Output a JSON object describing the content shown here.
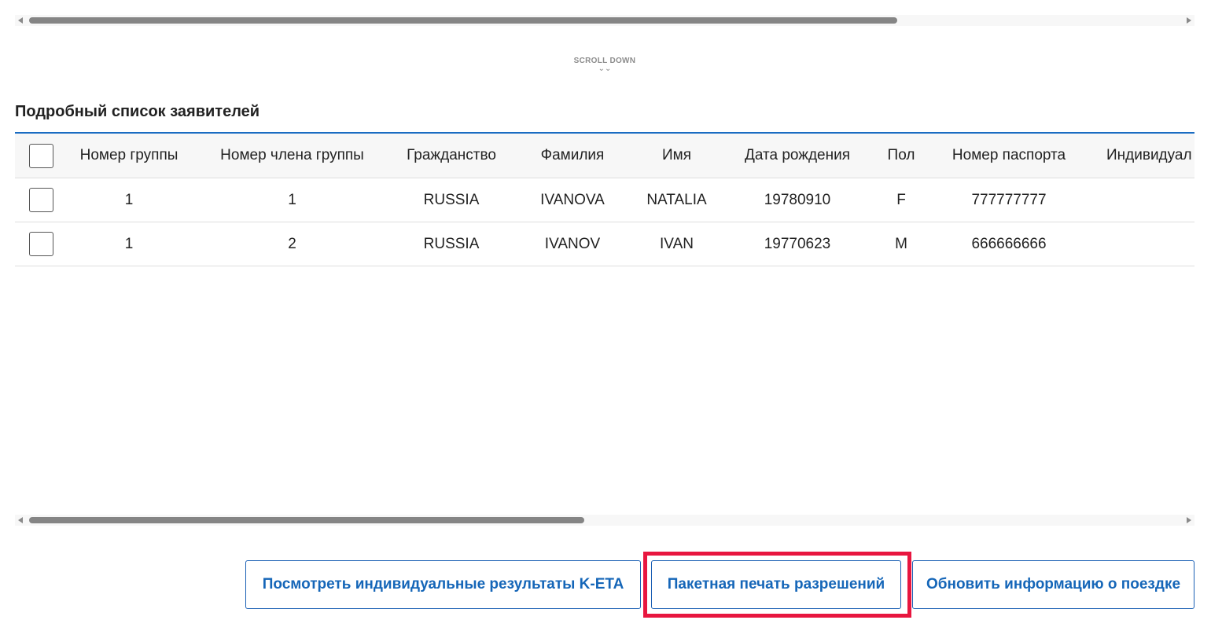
{
  "scroll_hint": {
    "label": "SCROLL DOWN",
    "chevron": "⌄⌄"
  },
  "section_title": "Подробный список заявителей",
  "table": {
    "columns": [
      "Номер группы",
      "Номер члена группы",
      "Гражданство",
      "Фамилия",
      "Имя",
      "Дата рождения",
      "Пол",
      "Номер паспорта",
      "Индивидуал"
    ],
    "rows": [
      {
        "group_no": "1",
        "member_no": "1",
        "citizenship": "RUSSIA",
        "surname": "IVANOVA",
        "name": "NATALIA",
        "birth_date": "19780910",
        "sex": "F",
        "passport": "777777777"
      },
      {
        "group_no": "1",
        "member_no": "2",
        "citizenship": "RUSSIA",
        "surname": "IVANOV",
        "name": "IVAN",
        "birth_date": "19770623",
        "sex": "M",
        "passport": "666666666"
      }
    ]
  },
  "buttons": {
    "view_results": "Посмотреть индивидуальные результаты K-ETA",
    "batch_print": "Пакетная печать разрешений",
    "update_trip": "Обновить информацию о поездке"
  },
  "colors": {
    "accent": "#1a6cc2",
    "highlight": "#e8163f",
    "button_text": "#1566b8"
  }
}
